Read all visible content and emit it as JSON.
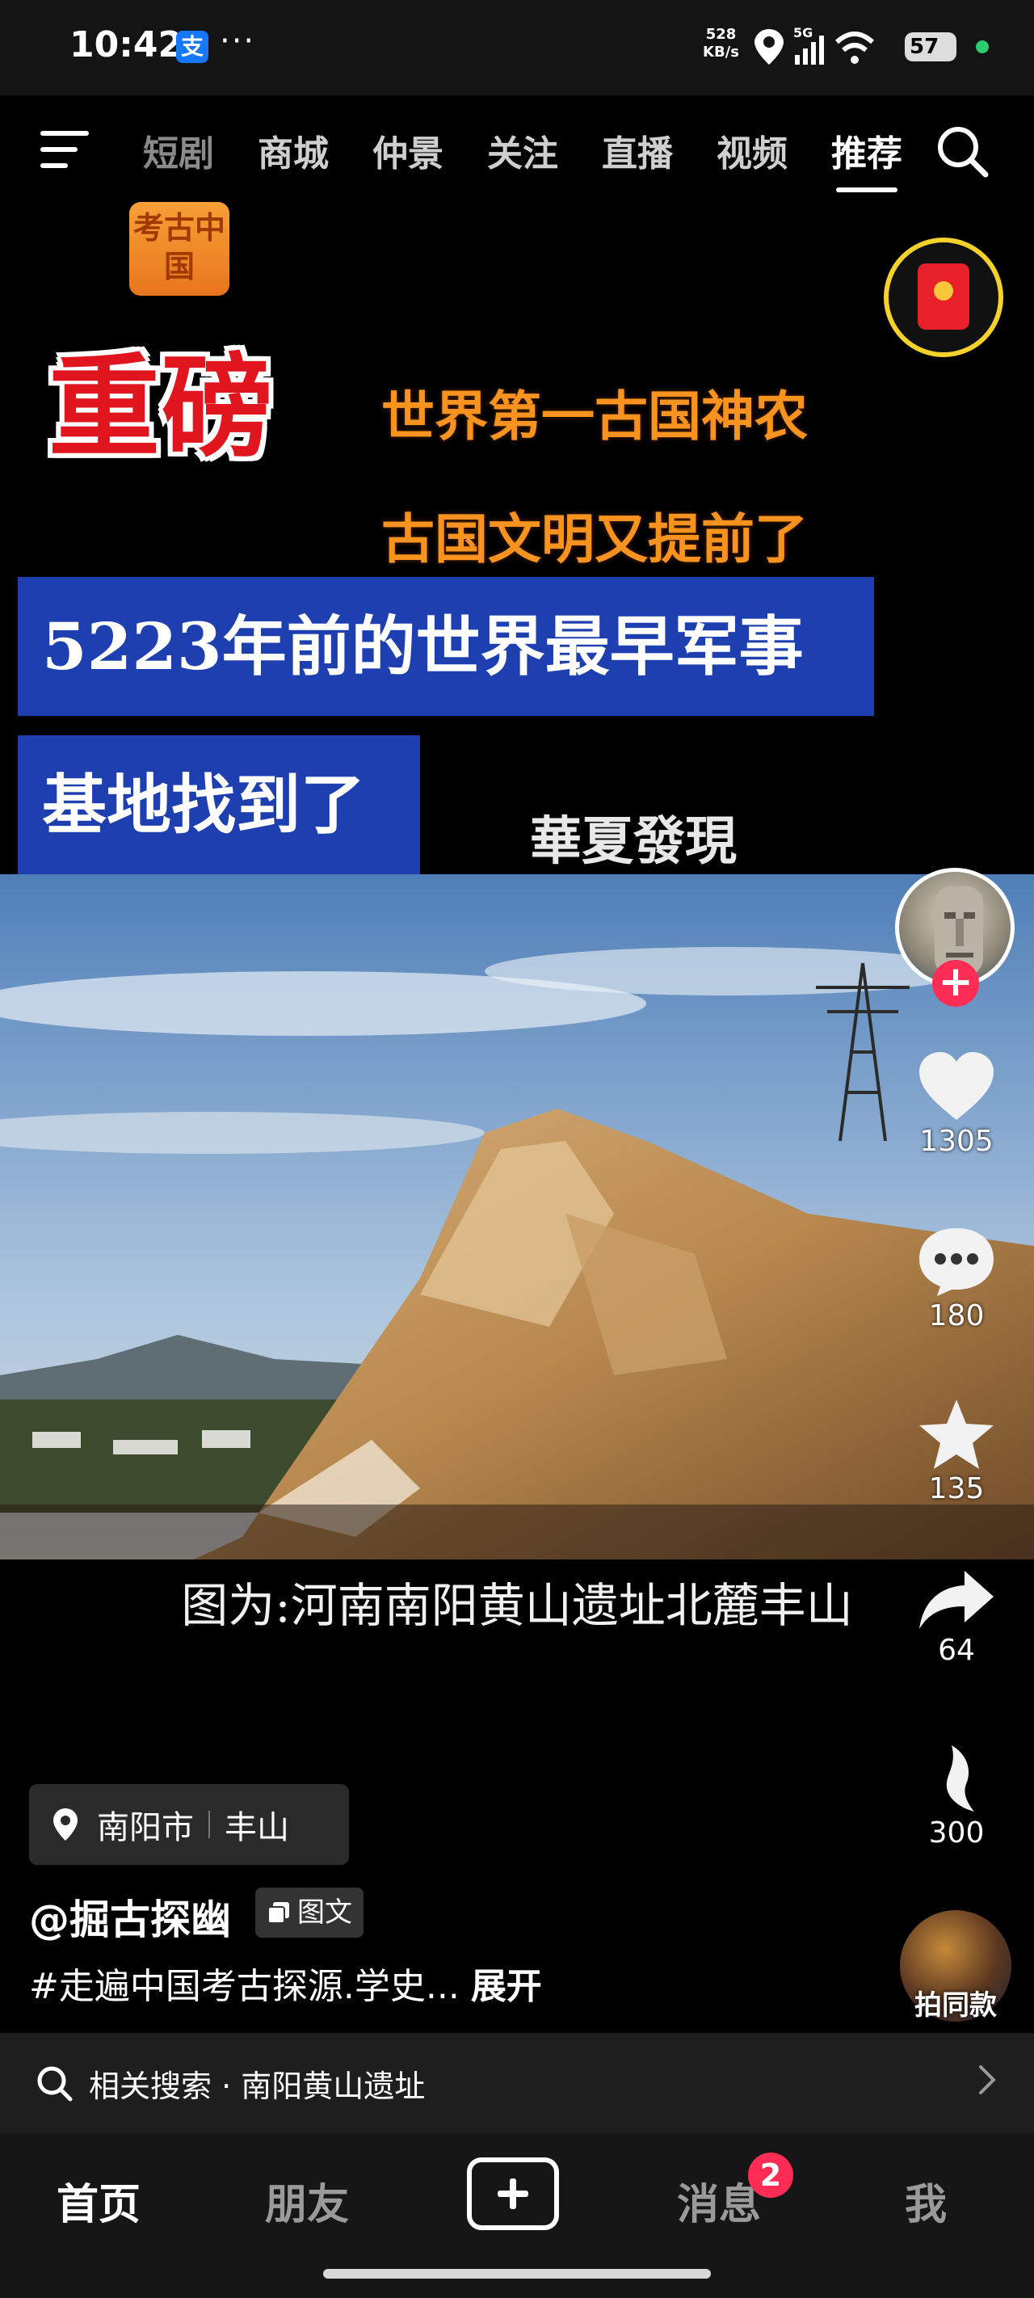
{
  "status_bar": {
    "time": "10:42",
    "alipay_glyph": "支",
    "more": "···",
    "speed_value": "528",
    "speed_unit": "KB/s",
    "network": "5G",
    "battery": "57"
  },
  "top_nav": {
    "tabs": [
      {
        "label": "短剧",
        "state": "faded"
      },
      {
        "label": "商城",
        "state": "normal"
      },
      {
        "label": "仲景",
        "state": "normal"
      },
      {
        "label": "关注",
        "state": "normal"
      },
      {
        "label": "直播",
        "state": "normal"
      },
      {
        "label": "视频",
        "state": "normal"
      },
      {
        "label": "推荐",
        "state": "active"
      }
    ]
  },
  "video": {
    "logo_text": "考古中国",
    "headline_big": "重磅",
    "headline_line1": "世界第一古国神农",
    "headline_line2": "古国文明又提前了",
    "banner1": "5223年前的世界最早军事",
    "banner2": "基地找到了",
    "watermark": "華夏發現",
    "caption": "图为:河南南阳黄山遗址北麓丰山"
  },
  "actions": {
    "likes": "1305",
    "comments": "180",
    "favorites": "135",
    "shares": "64",
    "extra": "300",
    "same_style_label": "拍同款"
  },
  "post": {
    "location_city": "南阳市",
    "location_place": "丰山",
    "author": "@掘古探幽",
    "type_tag": "图文",
    "description": "#走遍中国考古探源.学史...",
    "expand": "展开"
  },
  "related_search": {
    "label": "相关搜索 · 南阳黄山遗址"
  },
  "tab_bar": {
    "home": "首页",
    "friends": "朋友",
    "messages": "消息",
    "message_badge": "2",
    "me": "我"
  },
  "colors": {
    "accent_red": "#ff2c55",
    "banner_blue": "#1d3fb0",
    "headline_orange": "#f7931e",
    "packet_ring": "#f4d22b"
  }
}
